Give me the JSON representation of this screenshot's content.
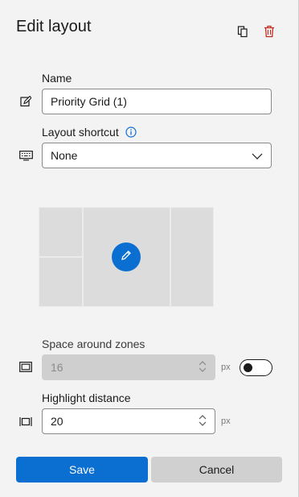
{
  "header": {
    "title": "Edit layout",
    "duplicate_icon": "copy-icon",
    "delete_icon": "trash-icon"
  },
  "name_field": {
    "label": "Name",
    "value": "Priority Grid (1)",
    "icon": "edit-icon"
  },
  "shortcut_field": {
    "label": "Layout shortcut",
    "value": "None",
    "icon": "keyboard-icon",
    "info_icon": "info-icon"
  },
  "space_field": {
    "label": "Space around zones",
    "value": "16",
    "unit": "px",
    "disabled": true,
    "toggle_on": false
  },
  "highlight_field": {
    "label": "Highlight distance",
    "value": "20",
    "unit": "px"
  },
  "buttons": {
    "save": "Save",
    "cancel": "Cancel"
  },
  "colors": {
    "accent": "#0a6fd1",
    "delete": "#c42b1c",
    "background": "#f3f3f3"
  }
}
